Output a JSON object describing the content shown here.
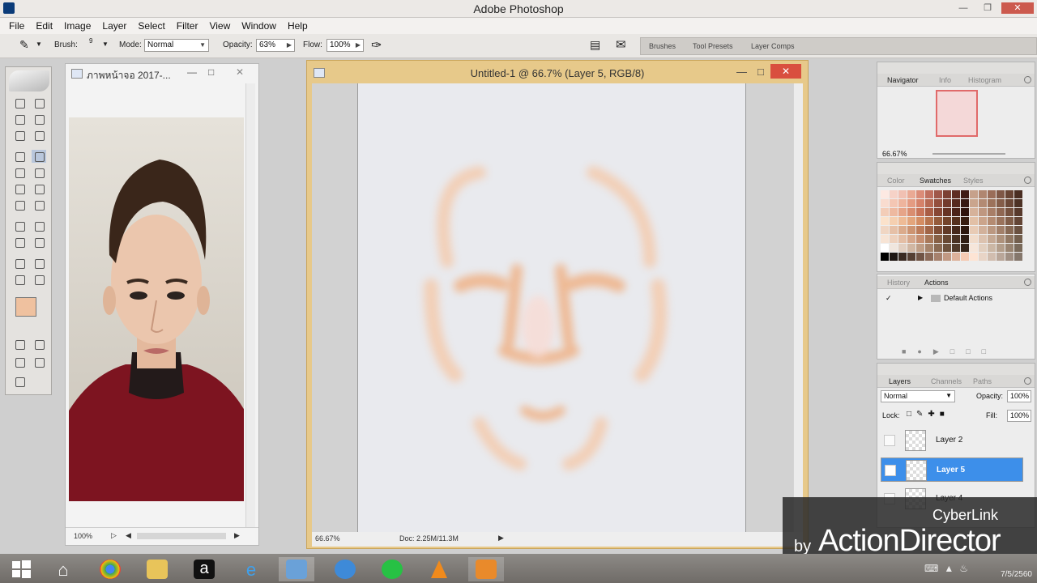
{
  "window": {
    "title": "Adobe Photoshop"
  },
  "menu": [
    "File",
    "Edit",
    "Image",
    "Layer",
    "Select",
    "Filter",
    "View",
    "Window",
    "Help"
  ],
  "options": {
    "brush_label": "Brush:",
    "brush_size": "9",
    "mode_label": "Mode:",
    "mode_value": "Normal",
    "opacity_label": "Opacity:",
    "opacity_value": "63%",
    "flow_label": "Flow:",
    "flow_value": "100%",
    "tabs": [
      "Brushes",
      "Tool Presets",
      "Layer Comps"
    ]
  },
  "colors": {
    "foreground": "#efc19f",
    "selected_layer": "#3d8fea",
    "canvas_window_frame": "#e7c98a"
  },
  "photo_doc": {
    "title": "ภาพหน้าจอ 2017-...",
    "zoom": "100%"
  },
  "canvas_doc": {
    "title": "Untitled-1 @ 66.7% (Layer 5, RGB/8)",
    "zoom": "66.67%",
    "doc_size": "Doc: 2.25M/11.3M"
  },
  "navigator": {
    "tabs": [
      "Navigator",
      "Info",
      "Histogram"
    ],
    "zoom": "66.67%"
  },
  "swatches": {
    "tabs": [
      "Color",
      "Swatches",
      "Styles"
    ],
    "colors": [
      "#fde9e2",
      "#f6d2c7",
      "#f1c0b2",
      "#eaa994",
      "#db8c78",
      "#c0705f",
      "#a0584a",
      "#7c4134",
      "#5e2c22",
      "#3f1b14",
      "#c6a18b",
      "#b08670",
      "#9a6d59",
      "#7f5746",
      "#684434",
      "#4a2e22",
      "#f9dccf",
      "#f4c6b3",
      "#eeb49d",
      "#e49b82",
      "#d5826a",
      "#b76953",
      "#944f3d",
      "#723a2c",
      "#55281d",
      "#361811",
      "#caa58d",
      "#b38a73",
      "#9c725b",
      "#845d49",
      "#6b4837",
      "#4d3225",
      "#f3cdb8",
      "#eeb9a0",
      "#e6a488",
      "#d98d70",
      "#c87459",
      "#a95d45",
      "#874634",
      "#663324",
      "#4a2218",
      "#2f130c",
      "#d6b29a",
      "#bf9780",
      "#a87e67",
      "#8f6752",
      "#75513e",
      "#57392b",
      "#fbe2cb",
      "#f5cfb0",
      "#eebb96",
      "#e3a57c",
      "#d48d63",
      "#b8744e",
      "#955b3b",
      "#73442b",
      "#55301d",
      "#371d10",
      "#e2c0a6",
      "#cba48b",
      "#b48b72",
      "#9a735c",
      "#805d48",
      "#634535",
      "#f0d6c3",
      "#e6c0a7",
      "#dbab8c",
      "#cd9472",
      "#bd7c5a",
      "#a16547",
      "#804e36",
      "#613a27",
      "#45281a",
      "#2c170d",
      "#e8cbb5",
      "#d2b19b",
      "#bb9881",
      "#a2806a",
      "#876954",
      "#6a5140",
      "#f7e4d5",
      "#eed1bd",
      "#e4bea5",
      "#d6a78b",
      "#c68f71",
      "#a87859",
      "#876045",
      "#674833",
      "#493223",
      "#2e1d13",
      "#f1dccb",
      "#dcc2af",
      "#c5a994",
      "#ad917b",
      "#917863",
      "#735f4d",
      "#ffffff",
      "#f0e6de",
      "#e2cfc1",
      "#d1b7a3",
      "#bf9e86",
      "#a6846b",
      "#8a6a52",
      "#6d523d",
      "#503b2b",
      "#33241a",
      "#f6e6da",
      "#e2cfbf",
      "#cbb7a5",
      "#b39e8b",
      "#998471",
      "#7a6a5a",
      "#000000",
      "#1f1612",
      "#3a2a22",
      "#553f33",
      "#705445",
      "#8b6a58",
      "#a6816d",
      "#c19983",
      "#dcb29b",
      "#f5cbb4",
      "#fde4d4",
      "#e8d4c6",
      "#d1bdaf",
      "#b9a699",
      "#a08f83",
      "#85776c"
    ]
  },
  "history": {
    "tabs": [
      "History",
      "Actions"
    ],
    "items": [
      "Default Actions"
    ]
  },
  "layers": {
    "tabs": [
      "Layers",
      "Channels",
      "Paths"
    ],
    "blend_mode": "Normal",
    "opacity_label": "Opacity:",
    "opacity_value": "100%",
    "lock_label": "Lock:",
    "fill_label": "Fill:",
    "fill_value": "100%",
    "items": [
      {
        "name": "Layer 2",
        "visible": false,
        "selected": false
      },
      {
        "name": "Layer 5",
        "visible": true,
        "selected": true
      },
      {
        "name": "Layer 4",
        "visible": true,
        "selected": false
      }
    ]
  },
  "watermark": {
    "line1": "CyberLink",
    "line2": "by",
    "line3": "ActionDirector"
  },
  "taskbar": {
    "date": "7/5/2560"
  }
}
